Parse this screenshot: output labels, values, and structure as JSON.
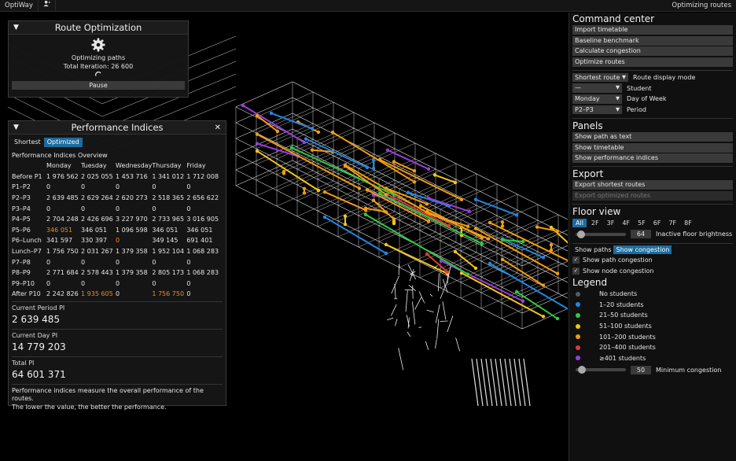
{
  "menubar": {
    "app": "OptiWay",
    "user_icon": "user-icon",
    "status": "Optimizing routes"
  },
  "route_window": {
    "title": "Route Optimization",
    "status": "Optimizing paths",
    "iteration": "Total Iteration: 26 600",
    "pause_label": "Pause"
  },
  "perf_window": {
    "title": "Performance Indices",
    "tabs": [
      "Shortest",
      "Optimized"
    ],
    "overview_title": "Performance Indices Overview",
    "days": [
      "Monday",
      "Tuesday",
      "Wednesday",
      "Thursday",
      "Friday"
    ],
    "rows": [
      {
        "label": "Before P1",
        "values": [
          "1 976 562",
          "2 025 055",
          "1 453 716",
          "1 341 012",
          "1 712 008"
        ]
      },
      {
        "label": "P1–P2",
        "values": [
          "0",
          "0",
          "0",
          "0",
          "0"
        ]
      },
      {
        "label": "P2–P3",
        "values": [
          "2 639 485",
          "2 629 264",
          "2 620 273",
          "2 518 365",
          "2 656 622"
        ]
      },
      {
        "label": "P3–P4",
        "values": [
          "0",
          "0",
          "0",
          "0",
          "0"
        ]
      },
      {
        "label": "P4–P5",
        "values": [
          "2 704 248",
          "2 426 696",
          "3 227 970",
          "2 733 965",
          "3 016 905"
        ]
      },
      {
        "label": "P5–P6",
        "values": [
          "346 051",
          "346 051",
          "1 096 598",
          "346 051",
          "346 051"
        ]
      },
      {
        "label": "P6–Lunch",
        "values": [
          "341 597",
          "330 397",
          "0",
          "349 145",
          "691 401"
        ]
      },
      {
        "label": "Lunch–P7",
        "values": [
          "1 756 750",
          "2 031 267",
          "1 379 358",
          "1 952 104",
          "1 068 283"
        ]
      },
      {
        "label": "P7–P8",
        "values": [
          "0",
          "0",
          "0",
          "0",
          "0"
        ]
      },
      {
        "label": "P8–P9",
        "values": [
          "2 771 684",
          "2 578 443",
          "1 379 358",
          "2 805 173",
          "1 068 283"
        ]
      },
      {
        "label": "P9–P10",
        "values": [
          "0",
          "0",
          "0",
          "0",
          "0"
        ]
      },
      {
        "label": "After P10",
        "values": [
          "2 242 826",
          "1 935 605",
          "0",
          "1 756 750",
          "0"
        ]
      }
    ],
    "current_period_label": "Current Period PI",
    "current_period_value": "2 639 485",
    "current_day_label": "Current Day PI",
    "current_day_value": "14 779 203",
    "total_label": "Total PI",
    "total_value": "64 601 371",
    "note_line1": "Performance indices measure the overall performance of the routes.",
    "note_line2": "The lower the value, the better the performance."
  },
  "sidebar": {
    "command_title": "Command center",
    "commands": [
      "Import timetable",
      "Baseline benchmark",
      "Calculate congestion",
      "Optimize routes"
    ],
    "route_mode_value": "Shortest route",
    "route_mode_label": "Route display mode",
    "student_value": "—",
    "student_label": "Student",
    "day_value": "Monday",
    "day_label": "Day of Week",
    "period_value": "P2–P3",
    "period_label": "Period",
    "panels_title": "Panels",
    "panels": [
      "Show path as text",
      "Show timetable",
      "Show performance indices"
    ],
    "export_title": "Export",
    "export_shortest": "Export shortest routes",
    "export_optimized": "Export optimized routes",
    "floor_title": "Floor view",
    "floors": [
      "All",
      "2F",
      "3F",
      "4F",
      "5F",
      "6F",
      "7F",
      "8F"
    ],
    "brightness_value": "64",
    "brightness_label": "Inactive floor brightness",
    "show_paths": "Show paths",
    "show_congestion": "Show congestion",
    "show_path_congestion": "Show path congestion",
    "show_node_congestion": "Show node congestion",
    "legend_title": "Legend",
    "legend": [
      {
        "label": "No students",
        "color": "#5a5a5a"
      },
      {
        "label": "1–20 students",
        "color": "#1e88e5"
      },
      {
        "label": "21–50 students",
        "color": "#2ecc40"
      },
      {
        "label": "51–100 students",
        "color": "#f5c518"
      },
      {
        "label": "101–200 students",
        "color": "#f39c12"
      },
      {
        "label": "201–400 students",
        "color": "#e53935"
      },
      {
        "label": "≥401 students",
        "color": "#9b3de0"
      }
    ],
    "min_congestion_value": "50",
    "min_congestion_label": "Minimum congestion"
  }
}
